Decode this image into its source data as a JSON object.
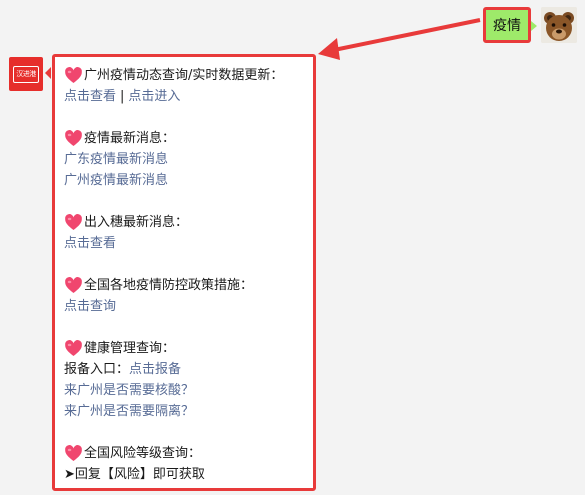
{
  "user_message": {
    "text": "疫情"
  },
  "bot_avatar": {
    "text": "汉进港"
  },
  "reply": {
    "sections": [
      {
        "title": "广州疫情动态查询/实时数据更新：",
        "links_inline": [
          "点击查看",
          "点击进入"
        ],
        "separator": "|"
      },
      {
        "title": "疫情最新消息：",
        "links": [
          "广东疫情最新消息",
          "广州疫情最新消息"
        ]
      },
      {
        "title": "出入穗最新消息：",
        "links": [
          "点击查看"
        ]
      },
      {
        "title": "全国各地疫情防控政策措施：",
        "links": [
          "点击查询"
        ]
      },
      {
        "title": "健康管理查询：",
        "report_label": "报备入口：",
        "report_link": "点击报备",
        "links": [
          "来广州是否需要核酸？",
          "来广州是否需要隔离？"
        ]
      },
      {
        "title": "全国风险等级查询：",
        "instruction": "➤回复【风险】即可获取"
      }
    ]
  },
  "colors": {
    "user_bubble": "#9eea6a",
    "highlight_border": "#e83a3a",
    "link": "#576b95",
    "heart": "#f0466e"
  },
  "icons": {
    "heart": "heart-icon",
    "arrow": "red-arrow"
  }
}
